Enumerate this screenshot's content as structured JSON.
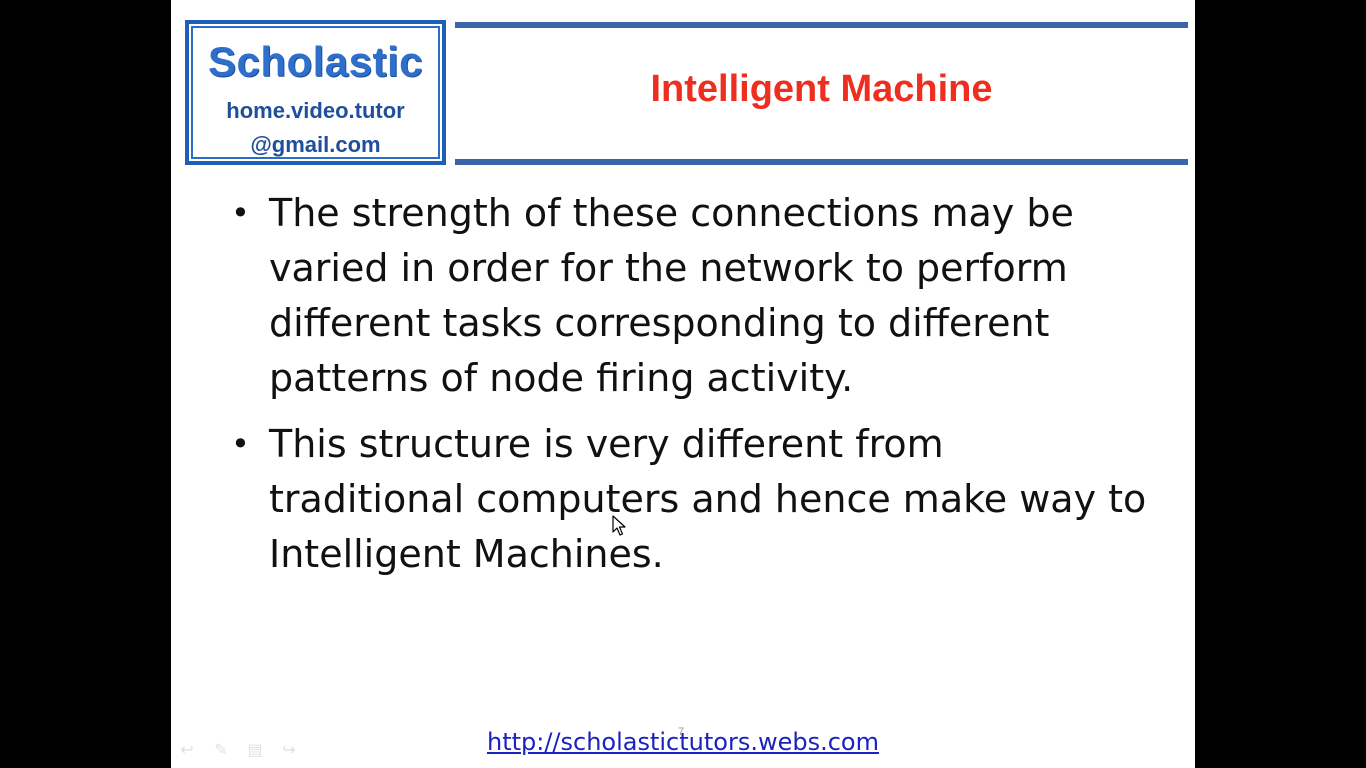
{
  "logo": {
    "title": "Scholastic",
    "line1": "home.video.tutor",
    "line2": "@gmail.com",
    "color": "#2f6fcc"
  },
  "slide": {
    "title": "Intelligent Machine",
    "title_color": "#ee2e1e",
    "bullets": [
      "The strength of these connections may be varied in order for the network to perform different tasks corresponding to different patterns of node firing activity.",
      "This structure is very different from traditional computers and hence make way to Intelligent Machines."
    ],
    "footer_link": "http://scholastictutors.webs.com",
    "slide_number": "7"
  },
  "toolbar": {
    "icons": [
      "previous-icon",
      "pen-icon",
      "menu-icon",
      "next-icon"
    ]
  }
}
